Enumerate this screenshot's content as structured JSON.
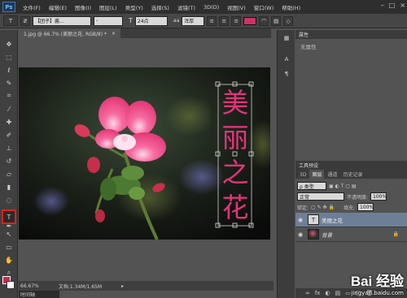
{
  "menu": {
    "app_logo": "Ps",
    "items": [
      "文件(F)",
      "编辑(E)",
      "图像(I)",
      "图层(L)",
      "类型(Y)",
      "选择(S)",
      "滤镜(T)",
      "3D(D)",
      "视图(V)",
      "窗口(W)",
      "帮助(H)"
    ],
    "win_min": "–",
    "win_max": "□",
    "win_close": "×"
  },
  "options": {
    "tool_icon": "T",
    "orient_icon": "⇵",
    "font_family": "【团子】酱...",
    "font_style": "-",
    "size_icon": "T",
    "font_size": "24点",
    "aa_icon": "aa",
    "anti_alias": "浑厚",
    "align_btn": "≡",
    "text_color": "#cc3366"
  },
  "document": {
    "tab_label": "1.jpg @ 66.7% (美丽之花, RGB/8) *",
    "tab_close": "×",
    "zoom": "66.67%",
    "doc_info": "文档:1.34M/1.65M",
    "status_arrow": "▸",
    "timeline": "时间轴",
    "vertical_text": [
      "美",
      "丽",
      "之",
      "花"
    ]
  },
  "properties": {
    "title": "属性",
    "empty_text": "无属性"
  },
  "layers_panel": {
    "tool_presets_title": "工具预设",
    "tabs": [
      "3D",
      "图层",
      "通道",
      "历史记录"
    ],
    "kind_label": "ρ 类型",
    "blend_mode": "正常",
    "opacity_label": "不透明度:",
    "opacity": "100%",
    "lock_label": "锁定:",
    "fill_label": "填充:",
    "fill": "100%",
    "layers": [
      {
        "name": "美丽之花",
        "thumb": "T"
      },
      {
        "name": "背景",
        "thumb": ""
      }
    ],
    "lock_icon": "🔒",
    "footer_icons": [
      "∞",
      "fx",
      "◐",
      "▤",
      "▭",
      "▢",
      "🗑"
    ]
  },
  "watermark": {
    "brand": "Bai 经验",
    "url": "jingyan.baidu.com"
  }
}
